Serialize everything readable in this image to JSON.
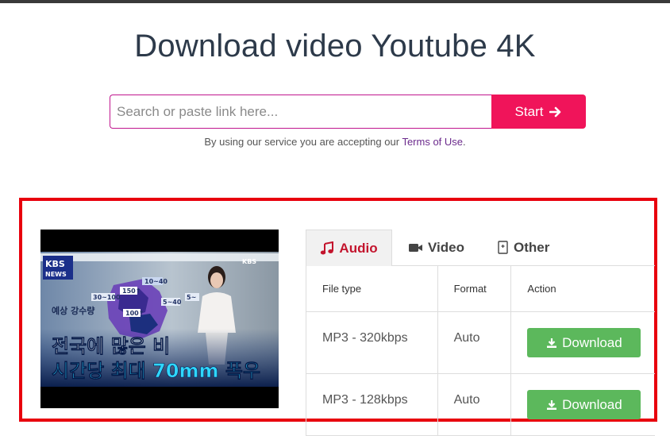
{
  "header": {
    "title": "Download video Youtube 4K"
  },
  "search": {
    "placeholder": "Search or paste link here...",
    "button_label": "Start"
  },
  "terms": {
    "prefix": "By using our service you are accepting our",
    "link": "Terms of Use",
    "suffix": "."
  },
  "thumbnail": {
    "brand": "KBS",
    "brand_sub": "NEWS",
    "corner_logo": "KBS",
    "caption_line1": "전국에 많은 비",
    "caption_line2": "시간당 최대 70mm 폭우",
    "map_label": "예상 강수량",
    "map_values": [
      "10~40",
      "150↑",
      "30~100",
      "5~40",
      "100↑",
      "5~"
    ]
  },
  "tabs": [
    {
      "label": "Audio",
      "icon": "music-note-icon",
      "active": true
    },
    {
      "label": "Video",
      "icon": "video-camera-icon",
      "active": false
    },
    {
      "label": "Other",
      "icon": "file-icon",
      "active": false
    }
  ],
  "table": {
    "headers": [
      "File type",
      "Format",
      "Action"
    ],
    "rows": [
      {
        "file_type": "MP3 - 320kbps",
        "format": "Auto",
        "action": "Download"
      },
      {
        "file_type": "MP3 - 128kbps",
        "format": "Auto",
        "action": "Download"
      }
    ]
  },
  "colors": {
    "accent": "#f0145a",
    "input_border": "#c0168e",
    "download": "#5cb85c",
    "active_tab": "#c3142d",
    "highlight": "#e8000d"
  }
}
